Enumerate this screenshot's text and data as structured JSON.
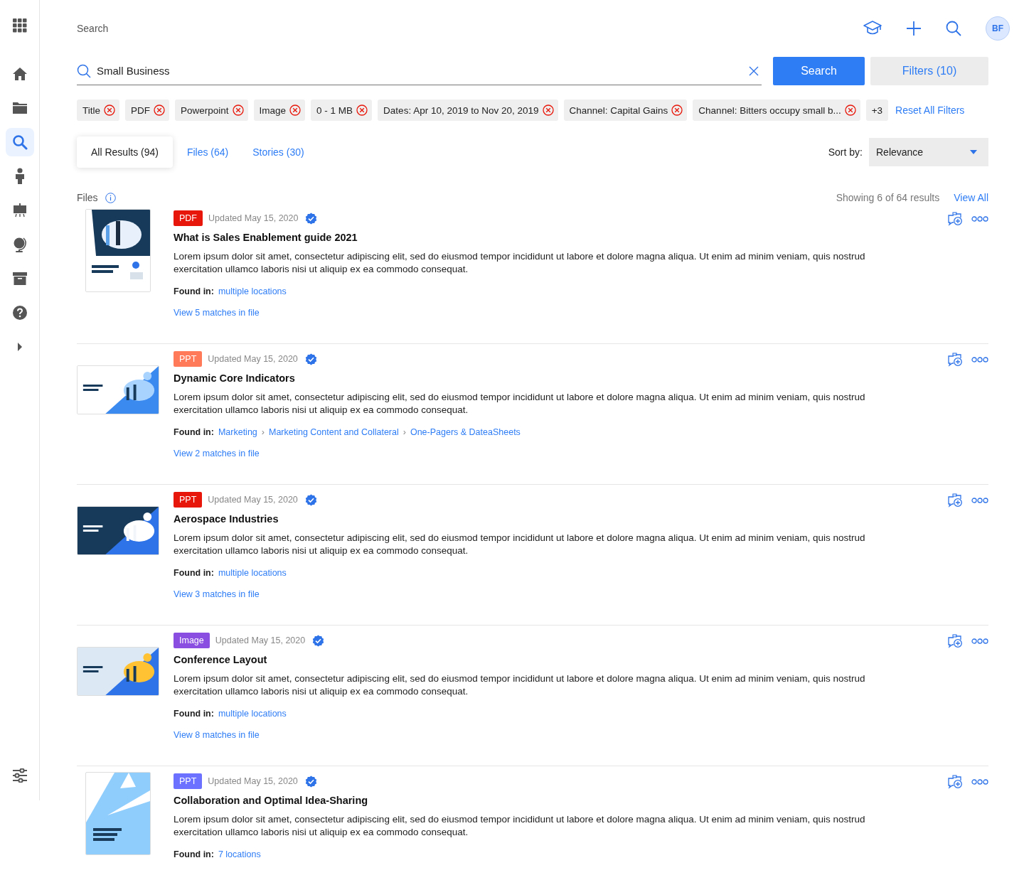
{
  "page_title": "Search",
  "user": {
    "initials": "BF"
  },
  "sidebar": {
    "items": [
      {
        "selected": false
      },
      {
        "selected": false
      },
      {
        "selected": true
      },
      {
        "selected": false
      },
      {
        "selected": false
      },
      {
        "selected": false
      },
      {
        "selected": false
      },
      {
        "selected": false
      },
      {
        "selected": false
      }
    ]
  },
  "breadcrumb_separator": "›",
  "search": {
    "value": "Small Business",
    "button": "Search",
    "filters_button": "Filters (10)"
  },
  "filter_chips": [
    {
      "label": "Title"
    },
    {
      "label": "PDF"
    },
    {
      "label": "Powerpoint"
    },
    {
      "label": "Image"
    },
    {
      "label": "0 - 1 MB"
    },
    {
      "label": "Dates: Apr 10, 2019 to Nov 20, 2019"
    },
    {
      "label": "Channel: Capital Gains"
    },
    {
      "label": "Channel: Bitters occupy small b..."
    }
  ],
  "more_filters": "+3",
  "reset_filters": "Reset All Filters",
  "tabs": [
    {
      "label": "All Results (94)",
      "selected": true
    },
    {
      "label": "Files (64)",
      "selected": false
    },
    {
      "label": "Stories (30)",
      "selected": false
    }
  ],
  "sort": {
    "label": "Sort by:",
    "value": "Relevance"
  },
  "section": {
    "title": "Files",
    "summary": "Showing 6 of 64 results",
    "view_all": "View All"
  },
  "results": [
    {
      "type": "PDF",
      "color": "#e8170b",
      "updated": "Updated May 15, 2020",
      "title": "What is Sales Enablement guide 2021",
      "description": "Lorem ipsum dolor sit amet, consectetur adipiscing elit, sed do eiusmod tempor incididunt ut labore et dolore magna aliqua. Ut enim ad minim veniam, quis nostrud exercitation ullamco laboris nisi ut aliquip ex ea commodo consequat.",
      "found_label": "Found in:",
      "found_in": [
        "multiple locations"
      ],
      "matches": "View 5 matches in file"
    },
    {
      "type": "PPT",
      "color": "#ff7a59",
      "updated": "Updated May 15, 2020",
      "title": "Dynamic Core Indicators",
      "description": "Lorem ipsum dolor sit amet, consectetur adipiscing elit, sed do eiusmod tempor incididunt ut labore et dolore magna aliqua. Ut enim ad minim veniam, quis nostrud exercitation ullamco laboris nisi ut aliquip ex ea commodo consequat.",
      "found_label": "Found in:",
      "found_in": [
        "Marketing",
        "Marketing Content and Collateral",
        "One-Pagers & DateaSheets"
      ],
      "matches": "View 2 matches in file"
    },
    {
      "type": "PPT",
      "color": "#e8170b",
      "updated": "Updated May 15, 2020",
      "title": "Aerospace Industries",
      "description": "Lorem ipsum dolor sit amet, consectetur adipiscing elit, sed do eiusmod tempor incididunt ut labore et dolore magna aliqua. Ut enim ad minim veniam, quis nostrud exercitation ullamco laboris nisi ut aliquip ex ea commodo consequat.",
      "found_label": "Found in:",
      "found_in": [
        "multiple locations"
      ],
      "matches": "View 3 matches in file"
    },
    {
      "type": "Image",
      "color": "#8a4fe0",
      "updated": "Updated May 15, 2020",
      "title": "Conference Layout",
      "description": "Lorem ipsum dolor sit amet, consectetur adipiscing elit, sed do eiusmod tempor incididunt ut labore et dolore magna aliqua. Ut enim ad minim veniam, quis nostrud exercitation ullamco laboris nisi ut aliquip ex ea commodo consequat.",
      "found_label": "Found in:",
      "found_in": [
        "multiple locations"
      ],
      "matches": "View 8 matches in file"
    },
    {
      "type": "PPT",
      "color": "#6c72ff",
      "updated": "Updated May 15, 2020",
      "title": "Collaboration and Optimal Idea-Sharing",
      "description": "Lorem ipsum dolor sit amet, consectetur adipiscing elit, sed do eiusmod tempor incididunt ut labore et dolore magna aliqua. Ut enim ad minim veniam, quis nostrud exercitation ullamco laboris nisi ut aliquip ex ea commodo consequat.",
      "found_label": "Found in:",
      "found_in": [
        "7 locations"
      ]
    }
  ]
}
